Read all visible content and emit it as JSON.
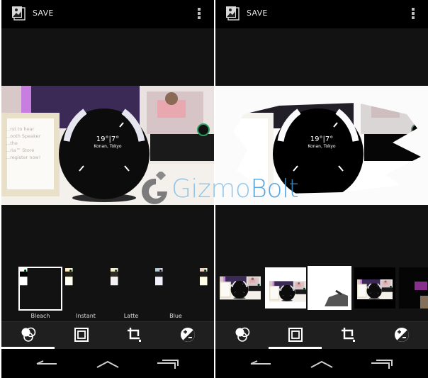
{
  "screens": [
    {
      "id": "left",
      "action_bar": {
        "save_label": "SAVE",
        "app_icon": "photo-editor-icon",
        "overflow_icon": "overflow-menu-icon"
      },
      "photo": {
        "weather_temp": "19°|7°",
        "weather_location": "Konan, Tokyo",
        "sign_text": [
          "...rst to hear",
          "...ooth Speaker",
          "...the",
          "...ria™ Store",
          "...register now!"
        ],
        "effect": "none"
      },
      "filmstrip": {
        "type": "filters",
        "items": [
          {
            "label": "",
            "tone": "bw",
            "selected": false
          },
          {
            "label": "Bleach",
            "tone": "bleach",
            "selected": true
          },
          {
            "label": "Instant",
            "tone": "instant",
            "selected": false
          },
          {
            "label": "Latte",
            "tone": "latte",
            "selected": false
          },
          {
            "label": "Blue",
            "tone": "blue",
            "selected": false
          },
          {
            "label": "",
            "tone": "partial",
            "selected": false
          }
        ]
      },
      "tabs": [
        {
          "name": "filters",
          "icon": "filters-icon",
          "active": true
        },
        {
          "name": "frames",
          "icon": "frame-icon",
          "active": false
        },
        {
          "name": "crop",
          "icon": "crop-icon",
          "active": false
        },
        {
          "name": "adjust",
          "icon": "exposure-icon",
          "active": false
        }
      ]
    },
    {
      "id": "right",
      "action_bar": {
        "save_label": "SAVE",
        "app_icon": "photo-editor-icon",
        "overflow_icon": "overflow-menu-icon"
      },
      "photo": {
        "weather_temp": "19°|7°",
        "weather_location": "Konan, Tokyo",
        "effect": "brush-stroke frame"
      },
      "filmstrip": {
        "type": "frames",
        "items": [
          {
            "label": "",
            "frame": "none",
            "selected": false
          },
          {
            "label": "",
            "frame": "white-corner",
            "selected": false
          },
          {
            "label": "",
            "frame": "brush-white",
            "selected": true
          },
          {
            "label": "",
            "frame": "black-border",
            "selected": false
          },
          {
            "label": "",
            "frame": "dark-grunge",
            "selected": false
          }
        ]
      },
      "tabs": [
        {
          "name": "filters",
          "icon": "filters-icon",
          "active": false
        },
        {
          "name": "frames",
          "icon": "frame-icon",
          "active": true
        },
        {
          "name": "crop",
          "icon": "crop-icon",
          "active": false
        },
        {
          "name": "adjust",
          "icon": "exposure-icon",
          "active": false
        }
      ]
    }
  ],
  "navbar": {
    "back": "back-icon",
    "home": "home-icon",
    "recents": "recents-icon"
  },
  "watermark": {
    "part1": "Gizmo",
    "part2": "Bolt"
  }
}
